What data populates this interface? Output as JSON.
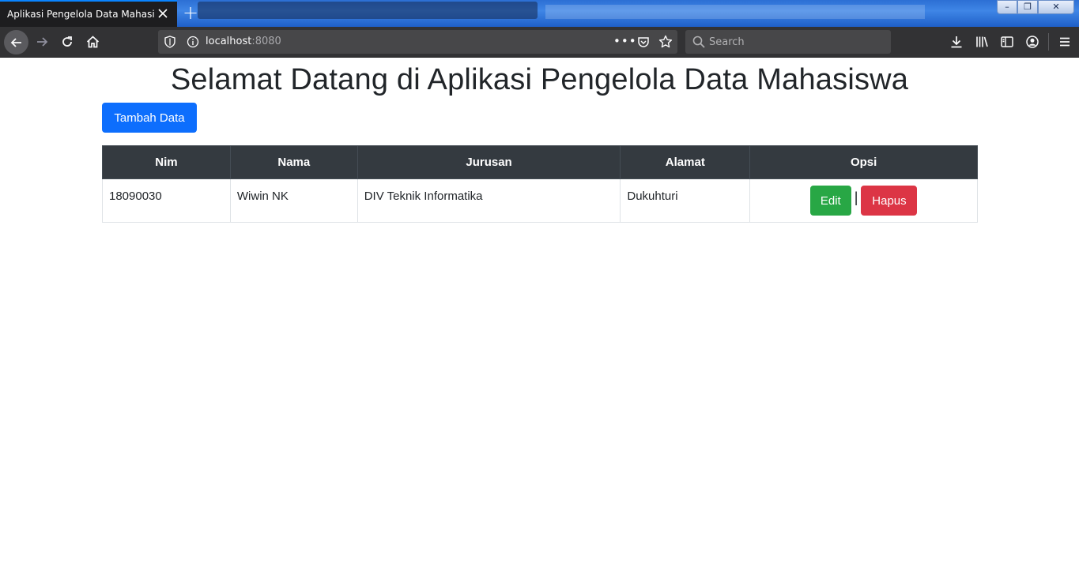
{
  "browser": {
    "tab_title": "Aplikasi Pengelola Data Mahasiswa",
    "new_tab_label": "+",
    "url_host": "localhost",
    "url_port": ":8080",
    "search_placeholder": "Search",
    "window_controls": {
      "minimize": "–",
      "maximize": "❐",
      "close": "✕"
    }
  },
  "page": {
    "title": "Selamat Datang di Aplikasi Pengelola Data Mahasiswa",
    "add_button": "Tambah Data",
    "table": {
      "headers": [
        "Nim",
        "Nama",
        "Jurusan",
        "Alamat",
        "Opsi"
      ],
      "rows": [
        {
          "nim": "18090030",
          "nama": "Wiwin NK",
          "jurusan": "DIV Teknik Informatika",
          "alamat": "Dukuhturi",
          "edit_label": "Edit",
          "separator": "|",
          "delete_label": "Hapus"
        }
      ]
    }
  },
  "colors": {
    "primary": "#0d6efd",
    "success": "#28a745",
    "danger": "#dc3545",
    "table_header": "#343a40"
  }
}
